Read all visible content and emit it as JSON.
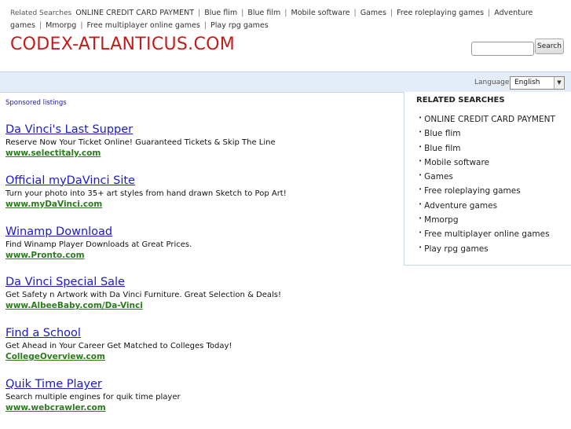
{
  "topbar": {
    "label": "Related Searches",
    "links": [
      "ONLINE CREDIT CARD PAYMENT",
      "Blue flim",
      "Blue film",
      "Mobile software",
      "Games",
      "Free roleplaying games",
      "Adventure games",
      "Mmorpg",
      "Free multiplayer online games",
      "Play rpg games"
    ],
    "separator": "|"
  },
  "header": {
    "site_title": "CODEX-ATLANTICUS.COM",
    "search_placeholder": "",
    "search_button": "Search"
  },
  "language": {
    "label": "Language:",
    "selected": "English",
    "arrow": "▼"
  },
  "sponsored_label": "Sponsored listings",
  "ads": [
    {
      "title": "Da Vinci's Last Supper",
      "desc": "Reserve Now Your Ticket Online! Guaranteed Tickets & Skip The Line",
      "url": "www.selectitaly.com"
    },
    {
      "title": "Official myDaVinci Site",
      "desc": "Turn your photo into 35+ art styles from hand drawn Sketch to Pop Art!",
      "url": "www.myDaVinci.com"
    },
    {
      "title": "Winamp Download",
      "desc": "Find Winamp Player Downloads at Great Prices.",
      "url": "www.Pronto.com"
    },
    {
      "title": "Da Vinci Special Sale",
      "desc": "Get Safety n Artwork with Da Vinci Furniture. Great Selection & Deals!",
      "url": "www.AlbeeBaby.com/Da-Vinci"
    },
    {
      "title": "Find a School",
      "desc": "Get Ahead in Your Career Get Matched to Colleges Today!",
      "url": "CollegeOverview.com"
    },
    {
      "title": "Quik Time Player",
      "desc": "Search multiple engines for quik time player",
      "url": "www.webcrawler.com"
    }
  ],
  "related": {
    "heading": "RELATED SEARCHES",
    "bullet": "•",
    "items": [
      "ONLINE CREDIT CARD PAYMENT",
      "Blue flim",
      "Blue film",
      "Mobile software",
      "Games",
      "Free roleplaying games",
      "Adventure games",
      "Mmorpg",
      "Free multiplayer online games",
      "Play rpg games"
    ]
  },
  "colors": {
    "title_red": "#c11c1c",
    "link_blue": "#1a1acc",
    "url_green": "#2b7a1e",
    "bar_blue": "#e4ecf7"
  }
}
